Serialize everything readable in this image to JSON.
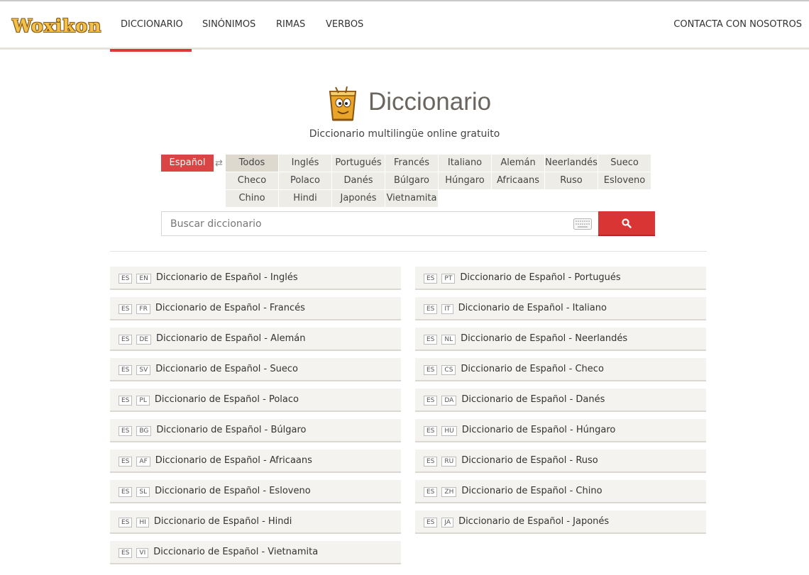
{
  "header": {
    "logo": "Woxikon",
    "nav": [
      {
        "label": "DICCIONARIO",
        "active": true
      },
      {
        "label": "SINÓNIMOS",
        "active": false
      },
      {
        "label": "RIMAS",
        "active": false
      },
      {
        "label": "VERBOS",
        "active": false
      }
    ],
    "contact": "CONTACTA CON NOSOTROS"
  },
  "hero": {
    "title": "Diccionario",
    "subtitle": "Diccionario multilingüe online gratuito",
    "icon": "dictionary-mascot-icon"
  },
  "language_picker": {
    "source": "Español",
    "targets": [
      "Todos",
      "Inglés",
      "Portugués",
      "Francés",
      "Italiano",
      "Alemán",
      "Neerlandés",
      "Sueco",
      "Checo",
      "Polaco",
      "Danés",
      "Búlgaro",
      "Húngaro",
      "Africaans",
      "Ruso",
      "Esloveno",
      "Chino",
      "Hindi",
      "Japonés",
      "Vietnamita"
    ],
    "selected": "Todos"
  },
  "search": {
    "placeholder": "Buscar diccionario",
    "value": ""
  },
  "colors": {
    "accent": "#d93535",
    "tile": "#eeece6",
    "item": "#f4f3ef"
  },
  "dictionaries": {
    "left": [
      {
        "from": "ES",
        "to": "EN",
        "label": "Diccionario de Español - Inglés"
      },
      {
        "from": "ES",
        "to": "FR",
        "label": "Diccionario de Español - Francés"
      },
      {
        "from": "ES",
        "to": "DE",
        "label": "Diccionario de Español - Alemán"
      },
      {
        "from": "ES",
        "to": "SV",
        "label": "Diccionario de Español - Sueco"
      },
      {
        "from": "ES",
        "to": "PL",
        "label": "Diccionario de Español - Polaco"
      },
      {
        "from": "ES",
        "to": "BG",
        "label": "Diccionario de Español - Búlgaro"
      },
      {
        "from": "ES",
        "to": "AF",
        "label": "Diccionario de Español - Africaans"
      },
      {
        "from": "ES",
        "to": "SL",
        "label": "Diccionario de Español - Esloveno"
      },
      {
        "from": "ES",
        "to": "HI",
        "label": "Diccionario de Español - Hindi"
      },
      {
        "from": "ES",
        "to": "VI",
        "label": "Diccionario de Español - Vietnamita"
      }
    ],
    "right": [
      {
        "from": "ES",
        "to": "PT",
        "label": "Diccionario de Español - Portugués"
      },
      {
        "from": "ES",
        "to": "IT",
        "label": "Diccionario de Español - Italiano"
      },
      {
        "from": "ES",
        "to": "NL",
        "label": "Diccionario de Español - Neerlandés"
      },
      {
        "from": "ES",
        "to": "CS",
        "label": "Diccionario de Español - Checo"
      },
      {
        "from": "ES",
        "to": "DA",
        "label": "Diccionario de Español - Danés"
      },
      {
        "from": "ES",
        "to": "HU",
        "label": "Diccionario de Español - Húngaro"
      },
      {
        "from": "ES",
        "to": "RU",
        "label": "Diccionario de Español - Ruso"
      },
      {
        "from": "ES",
        "to": "ZH",
        "label": "Diccionario de Español - Chino"
      },
      {
        "from": "ES",
        "to": "JA",
        "label": "Diccionario de Español - Japonés"
      }
    ]
  }
}
